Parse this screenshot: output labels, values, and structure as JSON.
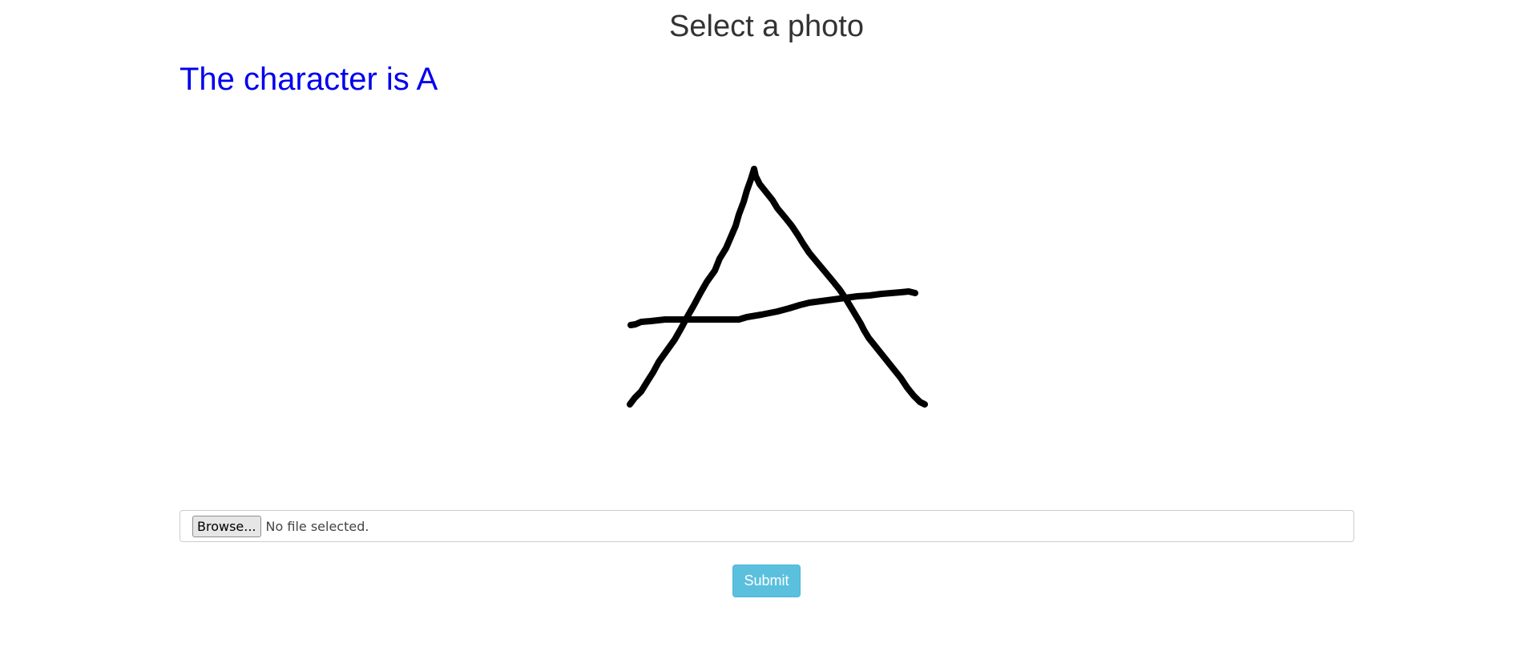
{
  "header": {
    "title": "Select a photo"
  },
  "result": {
    "text": "The character is A",
    "color": "#0000ee"
  },
  "image": {
    "alt": "handwritten letter A"
  },
  "file_input": {
    "browse_label": "Browse...",
    "status": "No file selected."
  },
  "form": {
    "submit_label": "Submit",
    "submit_color": "#5bc0de"
  }
}
